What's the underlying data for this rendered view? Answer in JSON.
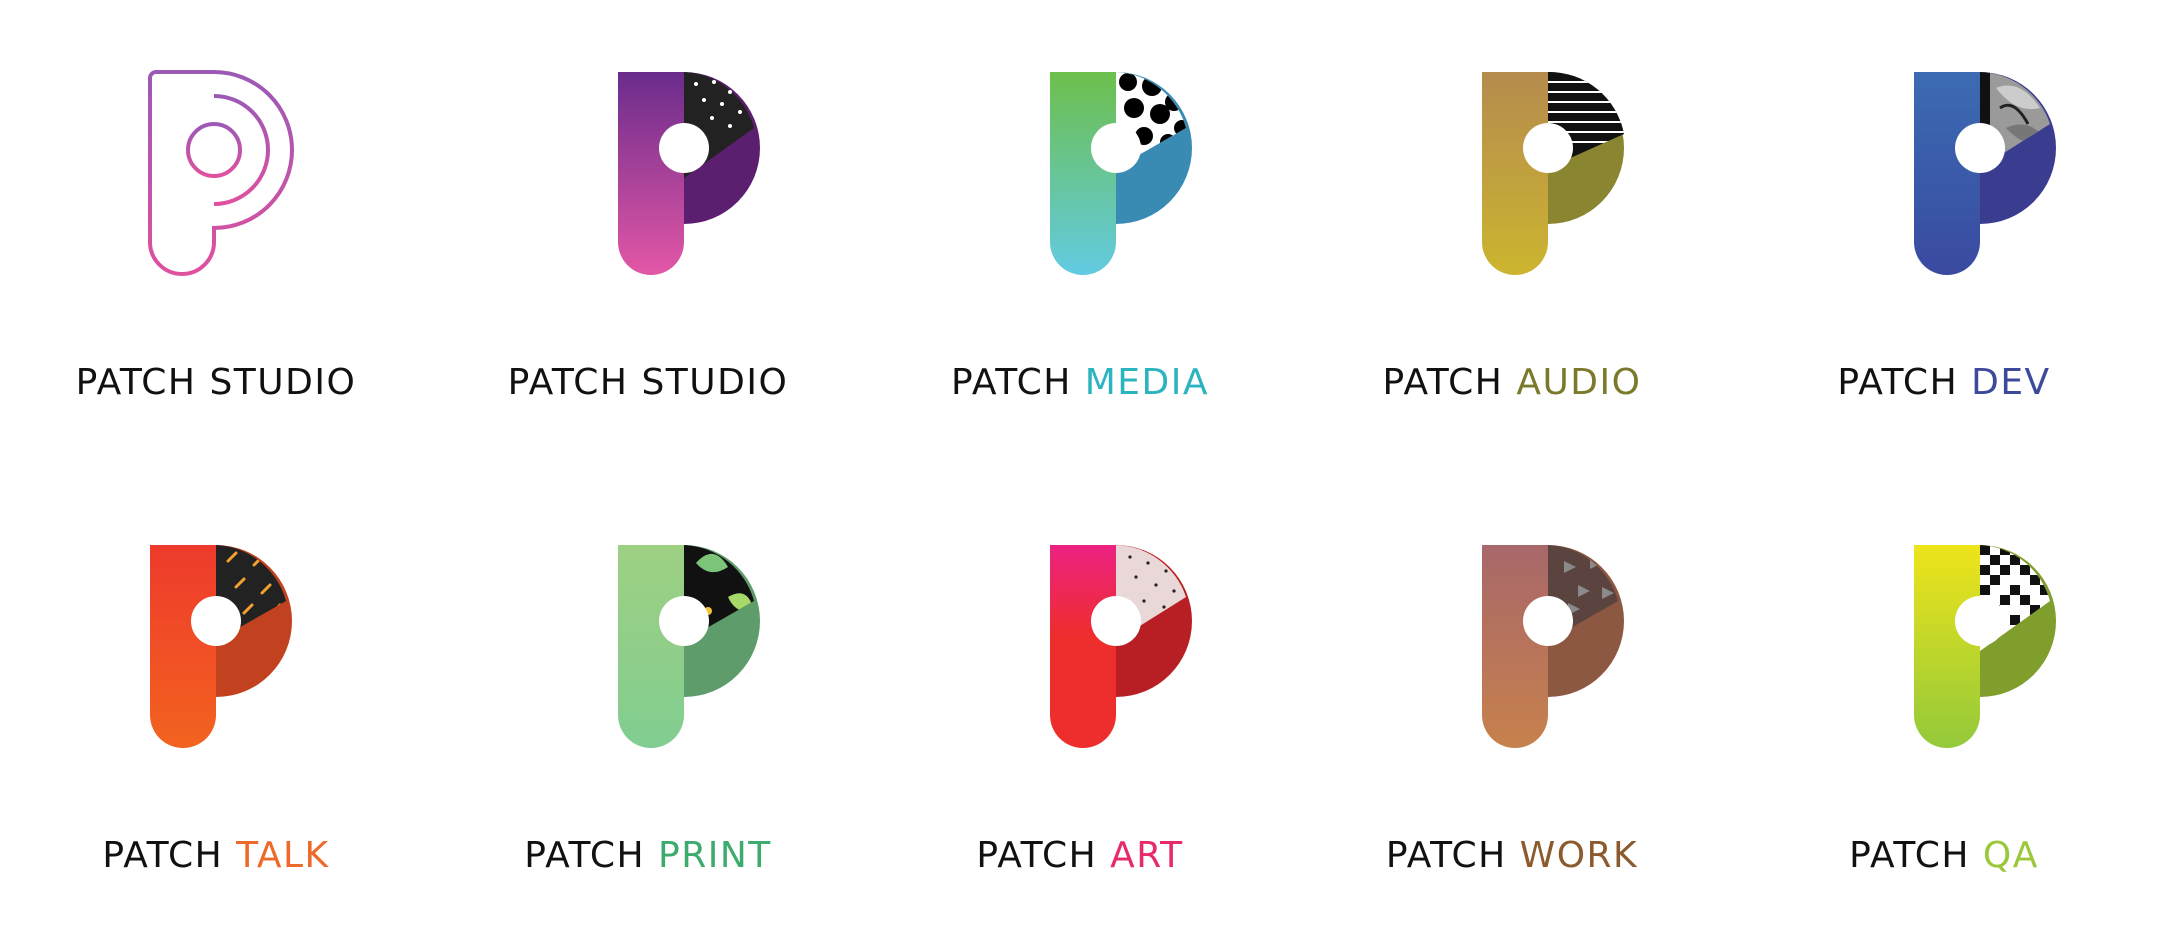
{
  "items": [
    {
      "prefix": "PATCH",
      "suffix": "STUDIO",
      "suffix_color": "#111111",
      "style": "outline",
      "g1": "#9b59b6",
      "g2": "#e0509f",
      "bowl": "#9b59b6",
      "pattern": "outline",
      "pattern_bg": "#ffffff"
    },
    {
      "prefix": "PATCH",
      "suffix": "STUDIO",
      "suffix_color": "#111111",
      "style": "solid",
      "g1": "#6a2c8c",
      "g2": "#e357a6",
      "bowl": "#5c1e6e",
      "pattern": "dots-small",
      "pattern_bg": "#222222"
    },
    {
      "prefix": "PATCH",
      "suffix": "MEDIA",
      "suffix_color": "#2bb3c0",
      "style": "solid",
      "g1": "#6dbf4b",
      "g2": "#62cbe2",
      "bowl": "#3a8bb3",
      "pattern": "dots-big",
      "pattern_bg": "#ffffff"
    },
    {
      "prefix": "PATCH",
      "suffix": "AUDIO",
      "suffix_color": "#7b7a2c",
      "style": "solid",
      "g1": "#b58b4e",
      "g2": "#ccb52f",
      "bowl": "#8a8531",
      "pattern": "stripes",
      "pattern_bg": "#111111"
    },
    {
      "prefix": "PATCH",
      "suffix": "DEV",
      "suffix_color": "#3d4a9c",
      "style": "solid",
      "g1": "#3b6bb3",
      "g2": "#3a4aa0",
      "bowl": "#3a3d8f",
      "pattern": "leaves-grey",
      "pattern_bg": "#9a9a9a"
    },
    {
      "prefix": "PATCH",
      "suffix": "TALK",
      "suffix_color": "#ee6a2b",
      "style": "solid",
      "g1": "#ee3a2c",
      "g2": "#f3631f",
      "bowl": "#c2421f",
      "pattern": "dashes",
      "pattern_bg": "#222222"
    },
    {
      "prefix": "PATCH",
      "suffix": "PRINT",
      "suffix_color": "#3dab6d",
      "style": "solid",
      "g1": "#9ed082",
      "g2": "#81cd91",
      "bowl": "#5f9c6b",
      "pattern": "leaves-green",
      "pattern_bg": "#111111"
    },
    {
      "prefix": "PATCH",
      "suffix": "ART",
      "suffix_color": "#e62a6b",
      "style": "solid",
      "g1": "#ec2283",
      "g2": "#ee2d2d",
      "bowl": "#b81f24",
      "pattern": "dots-pink",
      "pattern_bg": "#ead8d8"
    },
    {
      "prefix": "PATCH",
      "suffix": "WORK",
      "suffix_color": "#8b5a2e",
      "style": "solid",
      "g1": "#a8676a",
      "g2": "#c7814c",
      "bowl": "#8c5841",
      "pattern": "triangles",
      "pattern_bg": "#5b4340"
    },
    {
      "prefix": "PATCH",
      "suffix": "QA",
      "suffix_color": "#9bc73a",
      "style": "solid",
      "g1": "#eee41a",
      "g2": "#93c93b",
      "bowl": "#7f9e2c",
      "pattern": "pixels",
      "pattern_bg": "#ffffff"
    }
  ]
}
